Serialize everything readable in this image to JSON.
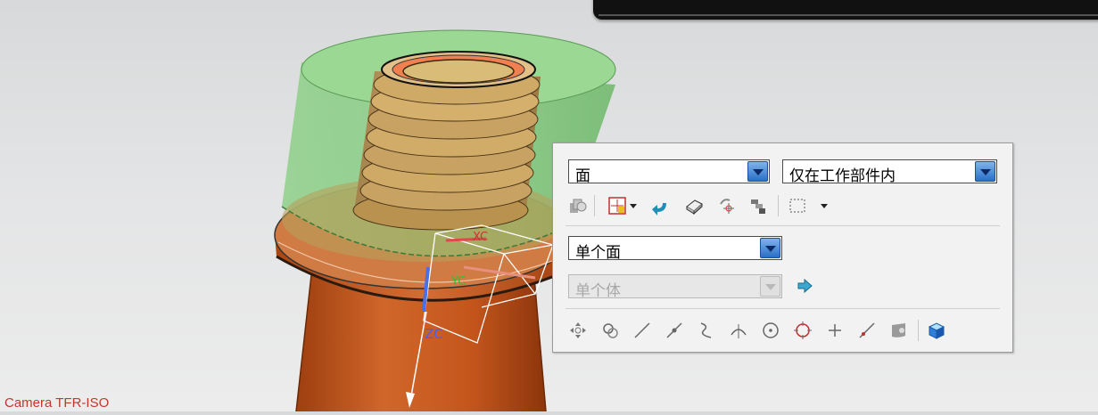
{
  "viewport": {
    "camera_label": "Camera TFR-ISO",
    "axis_labels": {
      "xc": "XC",
      "yc": "YC",
      "zc": "ZC"
    }
  },
  "selection_bar": {
    "type_filter": {
      "value": "面"
    },
    "scope": {
      "value": "仅在工作部件内"
    },
    "face_rule": {
      "value": "单个面"
    },
    "body_rule": {
      "value": "单个体",
      "enabled": false
    },
    "row1_icons": [
      "filter-icon",
      "type-filter-icon",
      "undo-selection-icon",
      "select-all-icon",
      "feature-point-icon",
      "gears-icon",
      "rectangle-select-icon"
    ],
    "row4_icons": [
      "snap-move-icon",
      "snap-center-icon",
      "line-end-icon",
      "midpoint-icon",
      "curve-point-icon",
      "tangent-icon",
      "arc-center-icon",
      "quadrant-icon",
      "existing-point-icon",
      "point-on-curve-icon",
      "point-on-face-icon",
      "view-cube-icon"
    ]
  },
  "colors": {
    "top_cap": "#7fca7a",
    "thread": "#c8a060",
    "flange": "#c85a1e",
    "shaft": "#c4561c",
    "camera_label": "#c0392b",
    "dropdown_accent": "#2a6fc7"
  }
}
